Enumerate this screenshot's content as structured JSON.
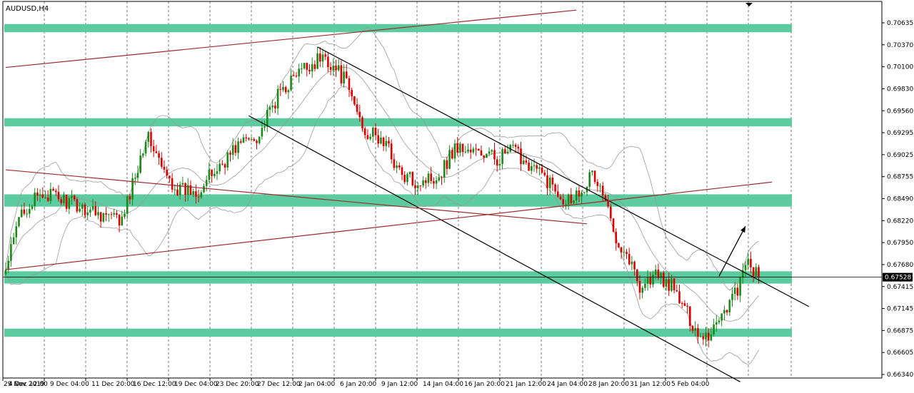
{
  "symbol_label": "AUDUSD,H4",
  "colors": {
    "background": "#ffffff",
    "bull": "#1a8a1a",
    "bear": "#e00000",
    "zone": "#5ccb9f",
    "bands": "#9a9a9a",
    "trend_dark": "#000000",
    "trend_red": "#9b2c2c",
    "grid": "#555555",
    "price_tag": "#000000"
  },
  "chart_data": {
    "type": "candlestick",
    "title": "AUDUSD,H4",
    "ylim": [
      0.6634,
      0.7075
    ],
    "y_ticks": [
      "0.70635",
      "0.70370",
      "0.70100",
      "0.69830",
      "0.69560",
      "0.69295",
      "0.69025",
      "0.68755",
      "0.68490",
      "0.68220",
      "0.67950",
      "0.67680",
      "0.67415",
      "0.67145",
      "0.66875",
      "0.66605",
      "0.66340"
    ],
    "x_ticks": [
      "29 Nov 2019",
      "4 Dec 12:00",
      "9 Dec 04:00",
      "11 Dec 20:00",
      "16 Dec 12:00",
      "19 Dec 04:00",
      "23 Dec 20:00",
      "27 Dec 12:00",
      "2 Jan 04:00",
      "6 Jan 20:00",
      "9 Jan 12:00",
      "14 Jan 04:00",
      "16 Jan 20:00",
      "21 Jan 12:00",
      "24 Jan 04:00",
      "28 Jan 20:00",
      "31 Jan 12:00",
      "5 Feb 04:00"
    ],
    "current_price": "0.67528",
    "candle_count": 208,
    "price_path": [
      [
        0,
        0.676
      ],
      [
        6,
        0.6835
      ],
      [
        15,
        0.6855
      ],
      [
        25,
        0.6843
      ],
      [
        35,
        0.6832
      ],
      [
        44,
        0.682
      ],
      [
        53,
        0.6925
      ],
      [
        55,
        0.6918
      ],
      [
        60,
        0.6878
      ],
      [
        66,
        0.6858
      ],
      [
        73,
        0.686
      ],
      [
        80,
        0.6885
      ],
      [
        88,
        0.6915
      ],
      [
        96,
        0.6928
      ],
      [
        104,
        0.698
      ],
      [
        112,
        0.7005
      ],
      [
        118,
        0.7018
      ],
      [
        121,
        0.7022
      ],
      [
        128,
        0.6995
      ],
      [
        136,
        0.6932
      ],
      [
        144,
        0.6915
      ],
      [
        150,
        0.6875
      ],
      [
        156,
        0.687
      ],
      [
        164,
        0.6878
      ],
      [
        170,
        0.6912
      ],
      [
        178,
        0.6905
      ],
      [
        186,
        0.6898
      ],
      [
        192,
        0.6908
      ],
      [
        198,
        0.6892
      ],
      [
        206,
        0.6868
      ],
      [
        212,
        0.6848
      ],
      [
        216,
        0.6855
      ],
      [
        222,
        0.6878
      ],
      [
        226,
        0.6855
      ],
      [
        230,
        0.681
      ],
      [
        236,
        0.6775
      ],
      [
        240,
        0.6742
      ],
      [
        246,
        0.6755
      ],
      [
        252,
        0.6742
      ],
      [
        258,
        0.6708
      ],
      [
        262,
        0.6684
      ],
      [
        266,
        0.6682
      ],
      [
        270,
        0.6705
      ],
      [
        274,
        0.6722
      ],
      [
        278,
        0.6745
      ],
      [
        281,
        0.6772
      ],
      [
        285,
        0.6752
      ]
    ],
    "support_resistance_zones": [
      {
        "from": 0.7052,
        "to": 0.7062
      },
      {
        "from": 0.6937,
        "to": 0.6947
      },
      {
        "from": 0.6839,
        "to": 0.6854
      },
      {
        "from": 0.6745,
        "to": 0.676
      },
      {
        "from": 0.668,
        "to": 0.669
      }
    ],
    "trendlines": [
      {
        "color": "dark",
        "from": [
          118,
          0.7034
        ],
        "to": [
          304,
          0.6717
        ]
      },
      {
        "color": "dark",
        "from": [
          92,
          0.695
        ],
        "to": [
          278,
          0.6625
        ]
      },
      {
        "color": "red",
        "from": [
          0,
          0.7009
        ],
        "to": [
          216,
          0.7079
        ]
      },
      {
        "color": "red",
        "from": [
          0,
          0.6884
        ],
        "to": [
          220,
          0.6818
        ]
      },
      {
        "color": "red",
        "from": [
          0,
          0.6762
        ],
        "to": [
          290,
          0.6869
        ]
      }
    ],
    "arrow": {
      "from": [
        270,
        0.6754
      ],
      "to": [
        280,
        0.6815
      ]
    },
    "legend": "none",
    "grid": "vertical dashed"
  }
}
